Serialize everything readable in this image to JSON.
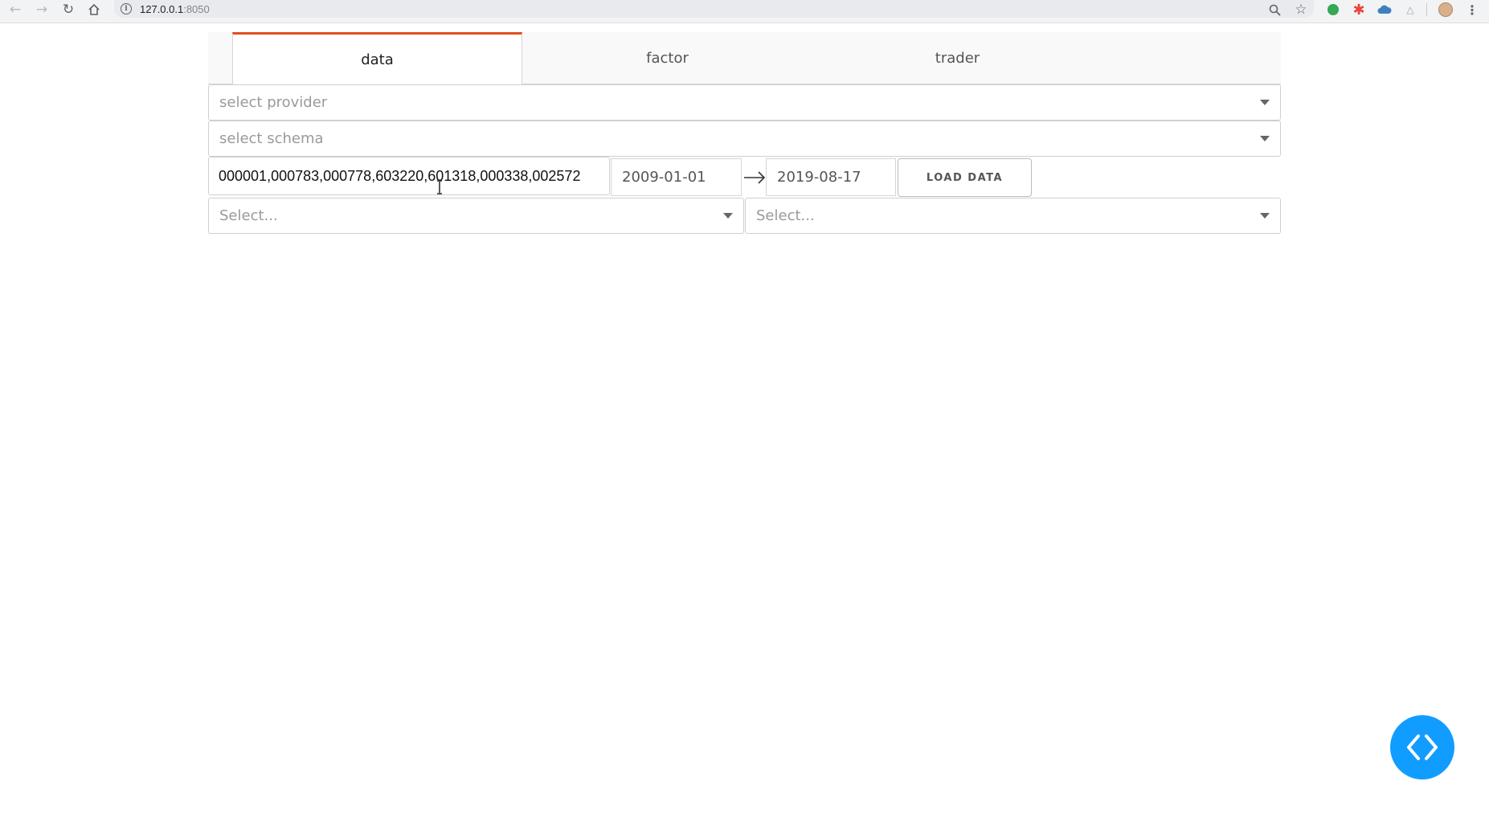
{
  "browser": {
    "url_host": "127.0.0.1",
    "url_port": ":8050",
    "back_icon": "arrow-left-icon",
    "forward_icon": "arrow-right-icon",
    "reload_icon": "reload-icon",
    "home_icon": "home-icon",
    "zoom_icon": "zoom-icon",
    "star_icon": "star-icon",
    "menu_icon": "kebab-menu-icon"
  },
  "tabs": [
    {
      "label": "data",
      "active": true
    },
    {
      "label": "factor",
      "active": false
    },
    {
      "label": "trader",
      "active": false
    }
  ],
  "provider_dropdown": {
    "placeholder": "select provider"
  },
  "schema_dropdown": {
    "placeholder": "select schema"
  },
  "codes_input": {
    "value": "000001,000783,000778,603220,601318,000338,002572"
  },
  "date_range": {
    "start": "2009-01-01",
    "end": "2019-08-17"
  },
  "load_button": {
    "label": "LOAD DATA"
  },
  "column_select_left": {
    "placeholder": "Select..."
  },
  "column_select_right": {
    "placeholder": "Select..."
  },
  "colors": {
    "accent_tab": "#e0501f",
    "fab": "#119dff"
  }
}
